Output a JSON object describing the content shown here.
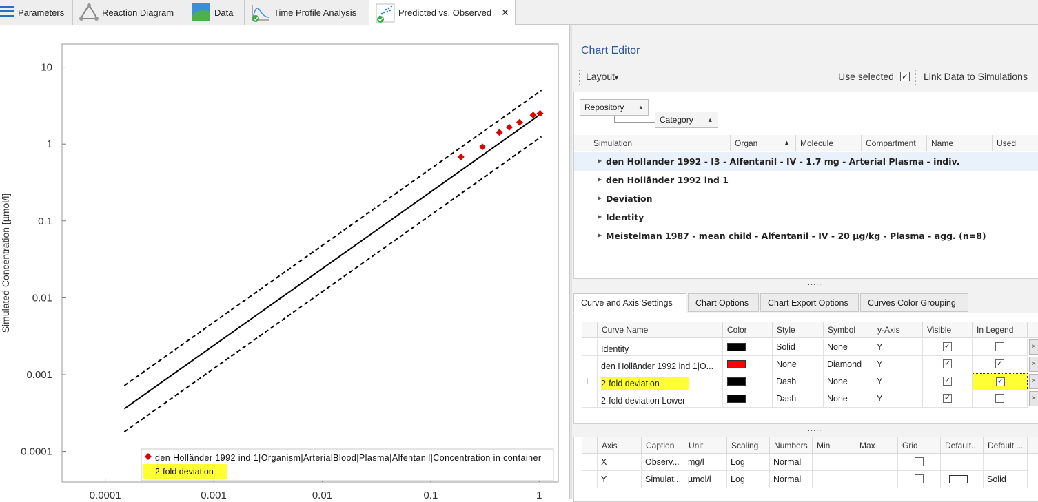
{
  "tabs": [
    {
      "label": "Parameters",
      "icon": "parameters-icon",
      "active": false
    },
    {
      "label": "Reaction Diagram",
      "icon": "reaction-diagram-icon",
      "active": false
    },
    {
      "label": "Data",
      "icon": "data-icon",
      "active": false
    },
    {
      "label": "Time Profile Analysis",
      "icon": "time-profile-icon",
      "active": false
    },
    {
      "label": "Predicted vs. Observed",
      "icon": "predicted-observed-icon",
      "active": true,
      "close": "✕"
    }
  ],
  "chart_data": {
    "type": "scatter",
    "ylabel": "Simulated Concentration [µmol/l]",
    "xlabel": "",
    "x_scale": "log",
    "y_scale": "log",
    "xlim": [
      4e-05,
      1.5
    ],
    "ylim": [
      4e-05,
      20
    ],
    "x_ticks": [
      {
        "v": 0.0001,
        "label": "0.0001"
      },
      {
        "v": 0.001,
        "label": "0.001"
      },
      {
        "v": 0.01,
        "label": "0.01"
      },
      {
        "v": 0.1,
        "label": "0.1"
      },
      {
        "v": 1,
        "label": "1"
      }
    ],
    "y_ticks": [
      {
        "v": 0.0001,
        "label": "0.0001"
      },
      {
        "v": 0.001,
        "label": "0.001"
      },
      {
        "v": 0.01,
        "label": "0.01"
      },
      {
        "v": 0.1,
        "label": "0.1"
      },
      {
        "v": 1,
        "label": "1"
      },
      {
        "v": 10,
        "label": "10"
      }
    ],
    "series": [
      {
        "name": "den Holländer 1992 ind 1|Organism|ArterialBlood|Plasma|Alfentanil|Concentration in container",
        "style": "marker-diamond",
        "color": "#e00000",
        "x": [
          0.19,
          0.3,
          0.43,
          0.53,
          0.66,
          0.88,
          1.02
        ],
        "y": [
          0.68,
          0.92,
          1.42,
          1.65,
          1.92,
          2.38,
          2.5
        ]
      },
      {
        "name": "Identity",
        "style": "solid",
        "color": "#000000",
        "x": [
          0.00015,
          1.05
        ],
        "y": [
          0.00036,
          2.5
        ]
      },
      {
        "name": "2-fold deviation",
        "style": "dash",
        "color": "#000000",
        "x": [
          0.00015,
          1.05
        ],
        "y": [
          0.00072,
          5.0
        ]
      },
      {
        "name": "2-fold deviation Lower",
        "style": "dash",
        "color": "#000000",
        "x": [
          0.00015,
          1.05
        ],
        "y": [
          0.00018,
          1.25
        ]
      }
    ],
    "legend": {
      "position": "bottom-center",
      "entries": [
        {
          "symbol": "◆",
          "text": "den Holländer 1992 ind 1|Organism|ArterialBlood|Plasma|Alfentanil|Concentration in container",
          "color": "#e00000"
        },
        {
          "symbol": "---",
          "text": "2-fold deviation",
          "highlight": true
        }
      ]
    },
    "grid": false
  },
  "editor": {
    "title": "Chart Editor",
    "layout_label": "Layout",
    "layout_arrow": "▾",
    "use_selected_label": "Use selected",
    "use_selected_checked": "✓",
    "link_data_label": "Link Data to Simulations",
    "group_by": [
      {
        "label": "Repository",
        "arrow": "▲"
      },
      {
        "label": "Category",
        "arrow": "▲"
      }
    ],
    "repo_columns": [
      "Simulation",
      "Organ",
      "Molecule",
      "Compartment",
      "Name",
      "Used"
    ],
    "organ_sort_arrow": "▲",
    "repo_groups": [
      "den Hollander 1992 - I3 - Alfentanil - IV - 1.7 mg - Arterial Plasma - indiv.",
      "den Holländer 1992 ind 1",
      "Deviation",
      "Identity",
      "Meistelman 1987 - mean child - Alfentanil - IV - 20 µg/kg - Plasma - agg. (n=8)"
    ],
    "splitter_dots": ".....",
    "settings_tabs": [
      "Curve and Axis Settings",
      "Chart Options",
      "Chart Export Options",
      "Curves Color Grouping"
    ],
    "curve_columns": [
      "Curve Name",
      "Color",
      "Style",
      "Symbol",
      "y-Axis",
      "Visible",
      "In Legend"
    ],
    "curves": [
      {
        "name": "Identity",
        "color": "#000000",
        "style": "Solid",
        "symbol": "None",
        "yaxis": "Y",
        "visible": "✓",
        "in_legend": ""
      },
      {
        "name": "den Holländer 1992 ind 1|O...",
        "color": "#ff0000",
        "style": "None",
        "symbol": "Diamond",
        "yaxis": "Y",
        "visible": "✓",
        "in_legend": "✓"
      },
      {
        "name": "2-fold deviation",
        "color": "#000000",
        "style": "Dash",
        "symbol": "None",
        "yaxis": "Y",
        "visible": "✓",
        "in_legend": "✓",
        "highlight": true
      },
      {
        "name": "2-fold deviation Lower",
        "color": "#000000",
        "style": "Dash",
        "symbol": "None",
        "yaxis": "Y",
        "visible": "✓",
        "in_legend": ""
      }
    ],
    "row_cursor": "I",
    "axis_columns": [
      "Axis",
      "Caption",
      "Unit",
      "Scaling",
      "Numbers",
      "Min",
      "Max",
      "Grid",
      "Default...",
      "Default ..."
    ],
    "axes": [
      {
        "axis": "X",
        "caption": "Observ...",
        "unit": "mg/l",
        "scaling": "Log",
        "numbers": "Normal",
        "min": "",
        "max": "",
        "grid": "",
        "default1": "",
        "default2": ""
      },
      {
        "axis": "Y",
        "caption": "Simulat...",
        "unit": "µmol/l",
        "scaling": "Log",
        "numbers": "Normal",
        "min": "",
        "max": "",
        "grid": "",
        "default1": "swatch",
        "default2": "Solid"
      }
    ]
  }
}
